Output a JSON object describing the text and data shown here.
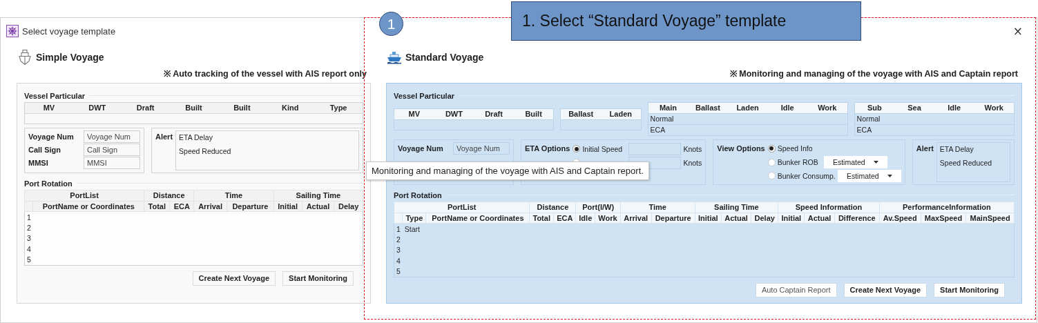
{
  "callout": {
    "number": "1",
    "text": "1. Select “Standard Voyage” template"
  },
  "window": {
    "title": "Select voyage template",
    "close": "×"
  },
  "templates": [
    {
      "title": "Simple Voyage",
      "note": "※ Auto tracking of the vessel with AIS report only",
      "selected": false,
      "vessel_particular": {
        "label": "Vessel Particular",
        "tables": [
          {
            "columns": [
              "MV",
              "DWT",
              "Draft",
              "Built",
              "Built",
              "Kind",
              "Type"
            ]
          }
        ]
      },
      "info_groups": [
        {
          "kind": "fields",
          "rows": [
            {
              "label": "Voyage Num",
              "placeholder": "Voyage Num"
            },
            {
              "label": "Call Sign",
              "placeholder": "Call Sign"
            },
            {
              "label": "MMSI",
              "placeholder": "MMSI"
            }
          ]
        },
        {
          "kind": "alert",
          "label": "Alert",
          "items": [
            "ETA Delay",
            "Speed Reduced"
          ]
        }
      ],
      "port_rotation": {
        "label": "Port Rotation",
        "groups": [
          {
            "name": "PortList",
            "columns": [
              "PortName or Coordinates"
            ]
          },
          {
            "name": "Distance",
            "columns": [
              "Total",
              "ECA"
            ]
          },
          {
            "name": "Time",
            "columns": [
              "Arrival",
              "Departure"
            ]
          },
          {
            "name": "Sailing Time",
            "columns": [
              "Initial",
              "Actual",
              "Delay"
            ]
          }
        ],
        "rows": [
          {
            "number": "1"
          },
          {
            "number": "2"
          },
          {
            "number": "3"
          },
          {
            "number": "4"
          },
          {
            "number": "5"
          }
        ]
      },
      "buttons": [
        {
          "label": "Create Next Voyage",
          "disabled": false
        },
        {
          "label": "Start Monitoring",
          "disabled": false
        }
      ]
    },
    {
      "title": "Standard Voyage",
      "note": "※ Monitoring and managing of the voyage with AIS and Captain report",
      "selected": true,
      "vessel_particular": {
        "label": "Vessel Particular",
        "tables": [
          {
            "columns": [
              "MV",
              "DWT",
              "Draft",
              "Built"
            ]
          },
          {
            "columns": [
              "Ballast",
              "Laden"
            ]
          },
          {
            "columns": [
              "Main",
              "Ballast",
              "Laden",
              "Idle",
              "Work"
            ],
            "row_labels": [
              "Normal",
              "ECA"
            ]
          },
          {
            "columns": [
              "Sub",
              "Sea",
              "Idle",
              "Work"
            ],
            "row_labels": [
              "Normal",
              "ECA"
            ]
          }
        ]
      },
      "info_groups": [
        {
          "kind": "fields",
          "rows": [
            {
              "label": "Voyage Num",
              "placeholder": "Voyage Num"
            }
          ]
        },
        {
          "kind": "radios",
          "label": "ETA Options",
          "options": [
            {
              "label": "Initial Speed",
              "selected": true,
              "unit": "Knots"
            },
            {
              "selected": false,
              "unit": "Knots"
            }
          ]
        },
        {
          "kind": "radios",
          "label": "View Options",
          "options": [
            {
              "label": "Speed Info",
              "selected": true
            },
            {
              "label": "Bunker ROB",
              "selected": false,
              "dropdown": "Estimated"
            },
            {
              "label": "Bunker Consump.",
              "selected": false,
              "dropdown": "Estimated"
            }
          ]
        },
        {
          "kind": "alert",
          "label": "Alert",
          "items": [
            "ETA Delay",
            "Speed Reduced"
          ]
        }
      ],
      "port_rotation": {
        "label": "Port Rotation",
        "groups": [
          {
            "name": "PortList",
            "columns": [
              "Type",
              "PortName or Coordinates"
            ]
          },
          {
            "name": "Distance",
            "columns": [
              "Total",
              "ECA"
            ]
          },
          {
            "name": "Port(I/W)",
            "columns": [
              "Idle",
              "Work"
            ]
          },
          {
            "name": "Time",
            "columns": [
              "Arrival",
              "Departure"
            ]
          },
          {
            "name": "Sailing Time",
            "columns": [
              "Initial",
              "Actual",
              "Delay"
            ]
          },
          {
            "name": "Speed Information",
            "columns": [
              "Initial",
              "Actual",
              "Difference"
            ]
          },
          {
            "name": "PerformanceInformation",
            "columns": [
              "Av.Speed",
              "MaxSpeed",
              "MainSpeed"
            ]
          }
        ],
        "rows": [
          {
            "number": "1",
            "cells": [
              "Start"
            ]
          },
          {
            "number": "2"
          },
          {
            "number": "3"
          },
          {
            "number": "4"
          },
          {
            "number": "5"
          }
        ]
      },
      "buttons": [
        {
          "label": "Auto Captain Report",
          "disabled": true
        },
        {
          "label": "Create Next Voyage",
          "disabled": false
        },
        {
          "label": "Start Monitoring",
          "disabled": false
        }
      ]
    }
  ],
  "tooltip": {
    "text": "Monitoring and managing of the voyage with AIS and Captain report."
  }
}
